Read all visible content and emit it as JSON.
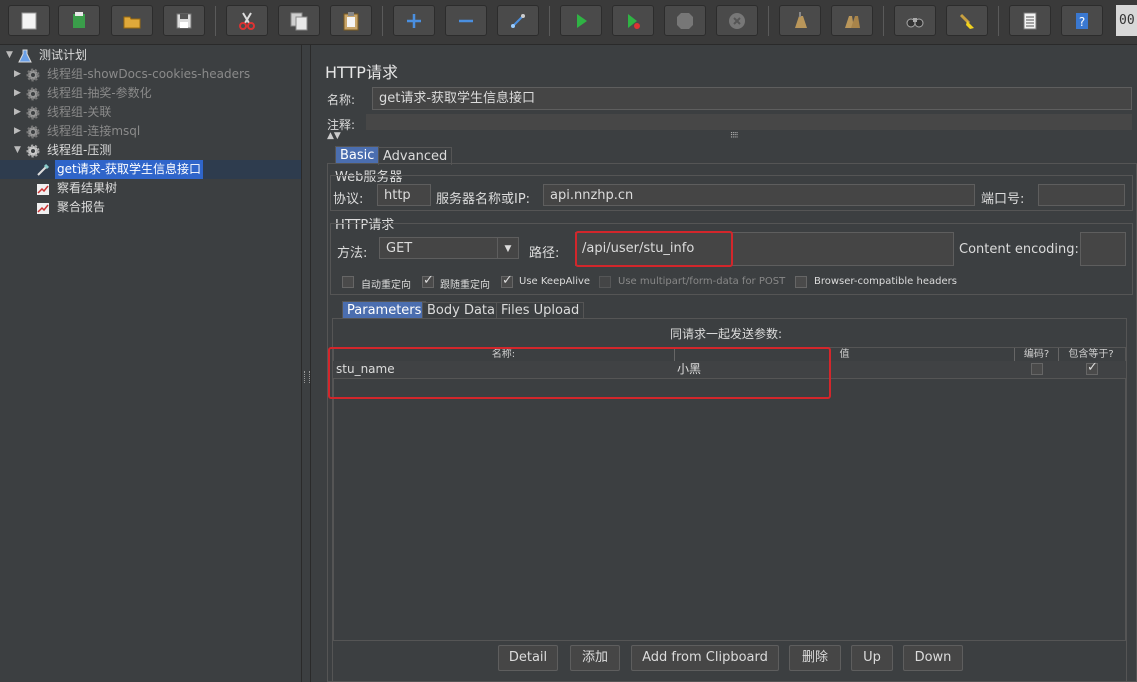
{
  "toolbar": {
    "counter": "00",
    "icons": [
      "new-icon",
      "templates-icon",
      "open-icon",
      "save-icon",
      "cut-icon",
      "copy-icon",
      "paste-icon",
      "expand-icon",
      "collapse-icon",
      "toggle-icon",
      "start-icon",
      "start-no-pause-icon",
      "stop-icon",
      "shutdown-icon",
      "clear-icon",
      "clear-all-icon",
      "search-icon",
      "reset-search-icon",
      "function-helper-icon",
      "help-icon"
    ]
  },
  "tree": {
    "root": "测试计划",
    "groups": [
      "线程组-showDocs-cookies-headers",
      "线程组-抽奖-参数化",
      "线程组-关联",
      "线程组-连接msql",
      "线程组-压测"
    ],
    "children": [
      "get请求-获取学生信息接口",
      "察看结果树",
      "聚合报告"
    ]
  },
  "panel": {
    "title": "HTTP请求",
    "name_label": "名称:",
    "name_value": "get请求-获取学生信息接口",
    "comment_label": "注释:",
    "tabs": {
      "basic": "Basic",
      "advanced": "Advanced"
    },
    "web_server": {
      "legend": "Web服务器",
      "protocol_label": "协议:",
      "protocol_value": "http",
      "server_label": "服务器名称或IP:",
      "server_value": "api.nnzhp.cn",
      "port_label": "端口号:",
      "port_value": ""
    },
    "http_request": {
      "legend": "HTTP请求",
      "method_label": "方法:",
      "method_value": "GET",
      "path_label": "路径:",
      "path_value": "/api/user/stu_info",
      "encoding_label": "Content encoding:",
      "encoding_value": ""
    },
    "options": {
      "auto_redirect": "自动重定向",
      "follow_redirect": "跟随重定向",
      "keepalive": "Use KeepAlive",
      "multipart": "Use multipart/form-data for POST",
      "browser_headers": "Browser-compatible headers"
    },
    "subtabs": {
      "parameters": "Parameters",
      "body": "Body Data",
      "files": "Files Upload"
    },
    "params_title": "同请求一起发送参数:",
    "columns": {
      "name": "名称:",
      "value": "值",
      "encode": "编码?",
      "include": "包含等于?"
    },
    "rows": [
      {
        "name": "stu_name",
        "value": "小黑"
      }
    ],
    "buttons": {
      "detail": "Detail",
      "add": "添加",
      "clipboard": "Add from Clipboard",
      "delete": "删除",
      "up": "Up",
      "down": "Down"
    }
  }
}
